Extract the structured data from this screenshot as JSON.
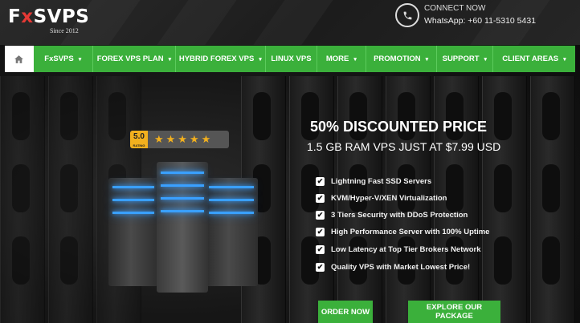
{
  "brand": {
    "logo_text_a": "F",
    "logo_text_x": "x",
    "logo_text_b": "SVPS",
    "since": "Since 2012"
  },
  "contact": {
    "heading": "CONNECT NOW",
    "whatsapp": "WhatsApp: +60 11-5310 5431",
    "icon": "phone-icon"
  },
  "nav": {
    "home_icon": "home-icon",
    "items": [
      {
        "label": "FxSVPS",
        "has_dropdown": true
      },
      {
        "label": "FOREX VPS PLAN",
        "has_dropdown": true
      },
      {
        "label": "HYBRID FOREX VPS",
        "has_dropdown": true
      },
      {
        "label": "LINUX VPS",
        "has_dropdown": false
      },
      {
        "label": "MORE",
        "has_dropdown": true
      },
      {
        "label": "PROMOTION",
        "has_dropdown": true
      },
      {
        "label": "SUPPORT",
        "has_dropdown": true
      },
      {
        "label": "CLIENT AREAS",
        "has_dropdown": true
      }
    ],
    "caret": "▾"
  },
  "rating": {
    "score": "5.0",
    "sub": "RATING",
    "stars": "★★★★★",
    "star_count": 5
  },
  "hero": {
    "headline": "50% DISCOUNTED PRICE",
    "subline": "1.5 GB RAM VPS JUST AT $7.99 USD",
    "features": [
      "Lightning Fast SSD Servers",
      "KVM/Hyper-V/XEN Virtualization",
      "3 Tiers Security with DDoS Protection",
      "High Performance Server with 100% Uptime",
      "Low Latency at Top Tier Brokers Network",
      "Quality VPS with Market Lowest Price!"
    ],
    "check_glyph": "✔"
  },
  "buttons": {
    "order": "ORDER NOW",
    "explore": "EXPLORE OUR PACKAGE"
  },
  "colors": {
    "accent_green": "#3bb03b",
    "star_gold": "#f2b01e",
    "led_blue": "#3aa0ff",
    "logo_red": "#e53935"
  }
}
